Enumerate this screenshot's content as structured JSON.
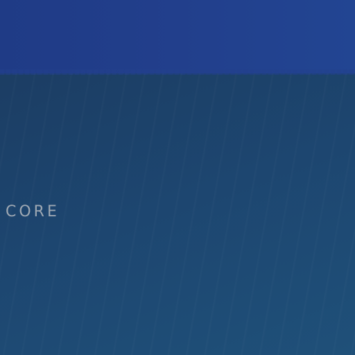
{
  "screen": {
    "label": "CORE"
  },
  "colors": {
    "top_band": "#223f8c",
    "background": "#1d4670",
    "label_text": "#9ea8b3"
  }
}
